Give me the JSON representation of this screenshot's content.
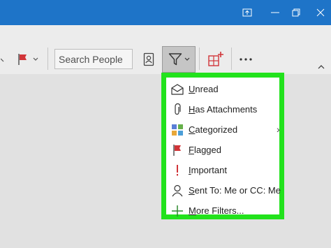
{
  "titlebar": {
    "buttons": [
      "present-icon",
      "restore-icon",
      "close-icon"
    ]
  },
  "toolbar": {
    "search_placeholder": "Search People",
    "icons": [
      "flag-icon",
      "chevron-down-icon",
      "address-book-icon",
      "filter-icon",
      "chevron-down-icon",
      "new-group-icon",
      "more-options-icon",
      "collapse-ribbon-icon"
    ]
  },
  "filter_menu": {
    "items": [
      {
        "label": "Unread",
        "icon": "envelope-open-icon",
        "mnemonic": "U"
      },
      {
        "label": "Has Attachments",
        "icon": "paperclip-icon",
        "mnemonic": "H"
      },
      {
        "label": "Categorized",
        "icon": "categories-icon",
        "mnemonic": "C",
        "has_submenu": true
      },
      {
        "label": "Flagged",
        "icon": "flag-icon",
        "mnemonic": "F"
      },
      {
        "label": "Important",
        "icon": "exclamation-icon",
        "mnemonic": "I"
      },
      {
        "label": "Sent To: Me or CC: Me",
        "icon": "person-icon",
        "mnemonic": "S"
      },
      {
        "label": "More Filters...",
        "icon": "plus-icon",
        "mnemonic": "M"
      }
    ]
  },
  "colors": {
    "titlebar": "#1e74c8",
    "highlight_border": "#22e21c",
    "flag": "#d13438",
    "important": "#d13438",
    "plus": "#2f8a2f"
  }
}
